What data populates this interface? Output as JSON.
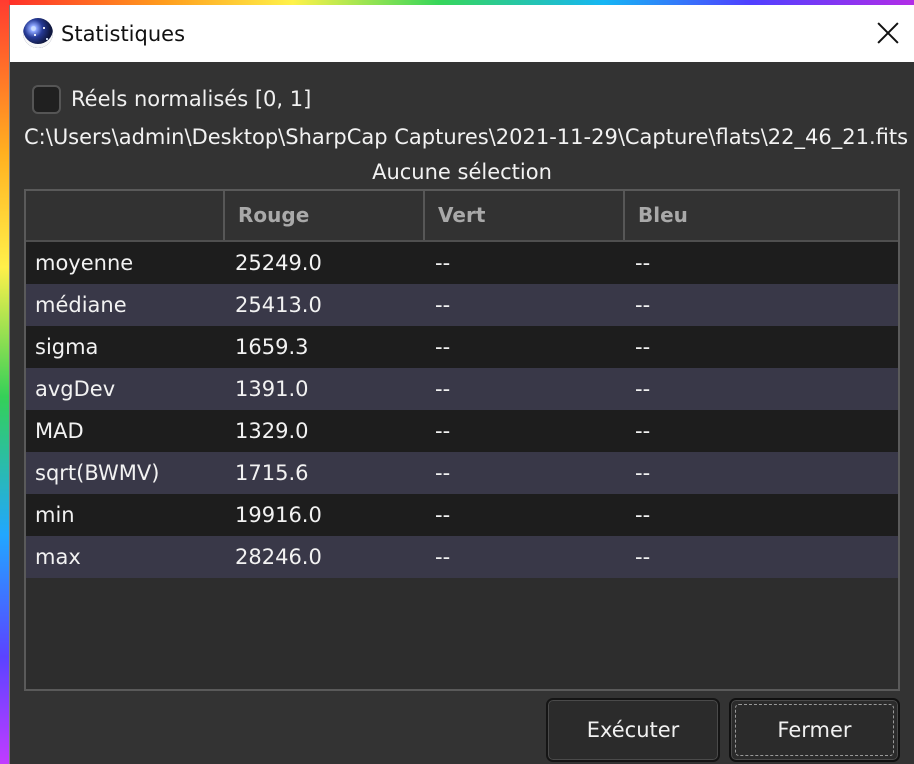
{
  "window": {
    "title": "Statistiques"
  },
  "options": {
    "normalized_label": "Réels normalisés [0, 1]"
  },
  "file": {
    "path": "C:\\Users\\admin\\Desktop\\SharpCap Captures\\2021-11-29\\Capture\\flats\\22_46_21.fits"
  },
  "selection": {
    "label": "Aucune sélection"
  },
  "table": {
    "headers": [
      "",
      "Rouge",
      "Vert",
      "Bleu"
    ],
    "rows": [
      [
        "moyenne",
        "25249.0",
        "--",
        "--"
      ],
      [
        "médiane",
        "25413.0",
        "--",
        "--"
      ],
      [
        "sigma",
        "1659.3",
        "--",
        "--"
      ],
      [
        "avgDev",
        "1391.0",
        "--",
        "--"
      ],
      [
        "MAD",
        "1329.0",
        "--",
        "--"
      ],
      [
        "sqrt(BWMV)",
        "1715.6",
        "--",
        "--"
      ],
      [
        "min",
        "19916.0",
        "--",
        "--"
      ],
      [
        "max",
        "28246.0",
        "--",
        "--"
      ]
    ]
  },
  "buttons": {
    "execute": "Exécuter",
    "close": "Fermer"
  },
  "icons": {
    "app": "siril-globe-icon",
    "close": "close-icon"
  },
  "colors": {
    "dialog_bg": "#333333",
    "row_dark": "#1d1d1d",
    "row_light": "#393848",
    "text": "#f2f2f2",
    "header_text": "#a9a9a9"
  }
}
